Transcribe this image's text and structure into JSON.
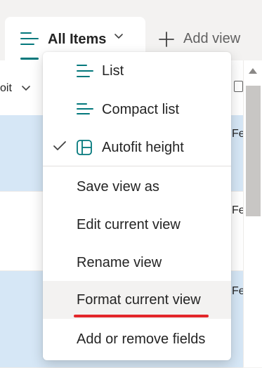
{
  "tabs": {
    "active_label": "All Items",
    "add_view_label": "Add view"
  },
  "list": {
    "column_partial": "oit",
    "cells": [
      "Fe",
      "Fe",
      "Fe"
    ]
  },
  "menu": {
    "items": [
      {
        "label": "List",
        "icon": "list-lines-icon"
      },
      {
        "label": "Compact list",
        "icon": "compact-list-icon"
      },
      {
        "label": "Autofit height",
        "icon": "autofit-height-icon",
        "checked": true
      }
    ],
    "actions": [
      "Save view as",
      "Edit current view",
      "Rename view",
      "Format current view",
      "Add or remove fields"
    ]
  },
  "colors": {
    "accent": "#03787c",
    "selected_row": "#d6e7f6",
    "highlight_underline": "#e3262a"
  }
}
